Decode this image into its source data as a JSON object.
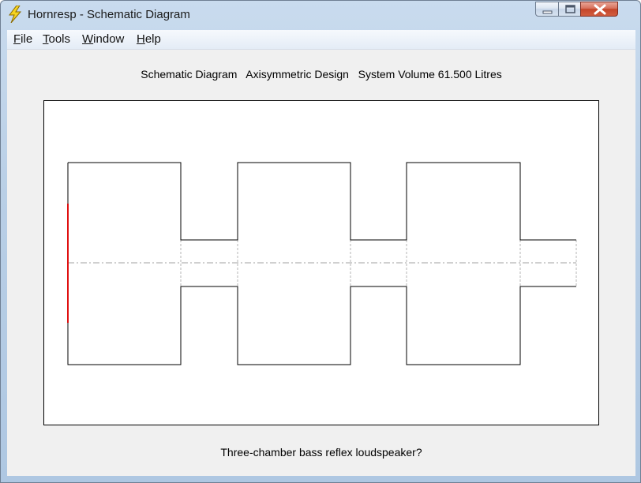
{
  "window": {
    "title": "Hornresp - Schematic Diagram",
    "icon": "lightning-bolt-icon",
    "controls": {
      "minimize_icon": "minimize-icon",
      "maximize_icon": "maximize-icon",
      "close_icon": "close-icon"
    }
  },
  "menu": {
    "file": {
      "label_first": "F",
      "label_rest": "ile"
    },
    "tools": {
      "label_first": "T",
      "label_rest": "ools"
    },
    "window": {
      "label_first": "W",
      "label_rest": "indow"
    },
    "help": {
      "label_first": "H",
      "label_rest": "elp"
    }
  },
  "header": {
    "text": "Schematic Diagram   Axisymmetric Design   System Volume 61.500 Litres"
  },
  "diagram": {
    "outline_color": "#000000",
    "driver_color": "#e01010",
    "axis_color": "#a0a0a0",
    "port_boundary_color": "#b4b4b4"
  },
  "caption": {
    "text": "Three-chamber bass reflex loudspeaker?"
  }
}
